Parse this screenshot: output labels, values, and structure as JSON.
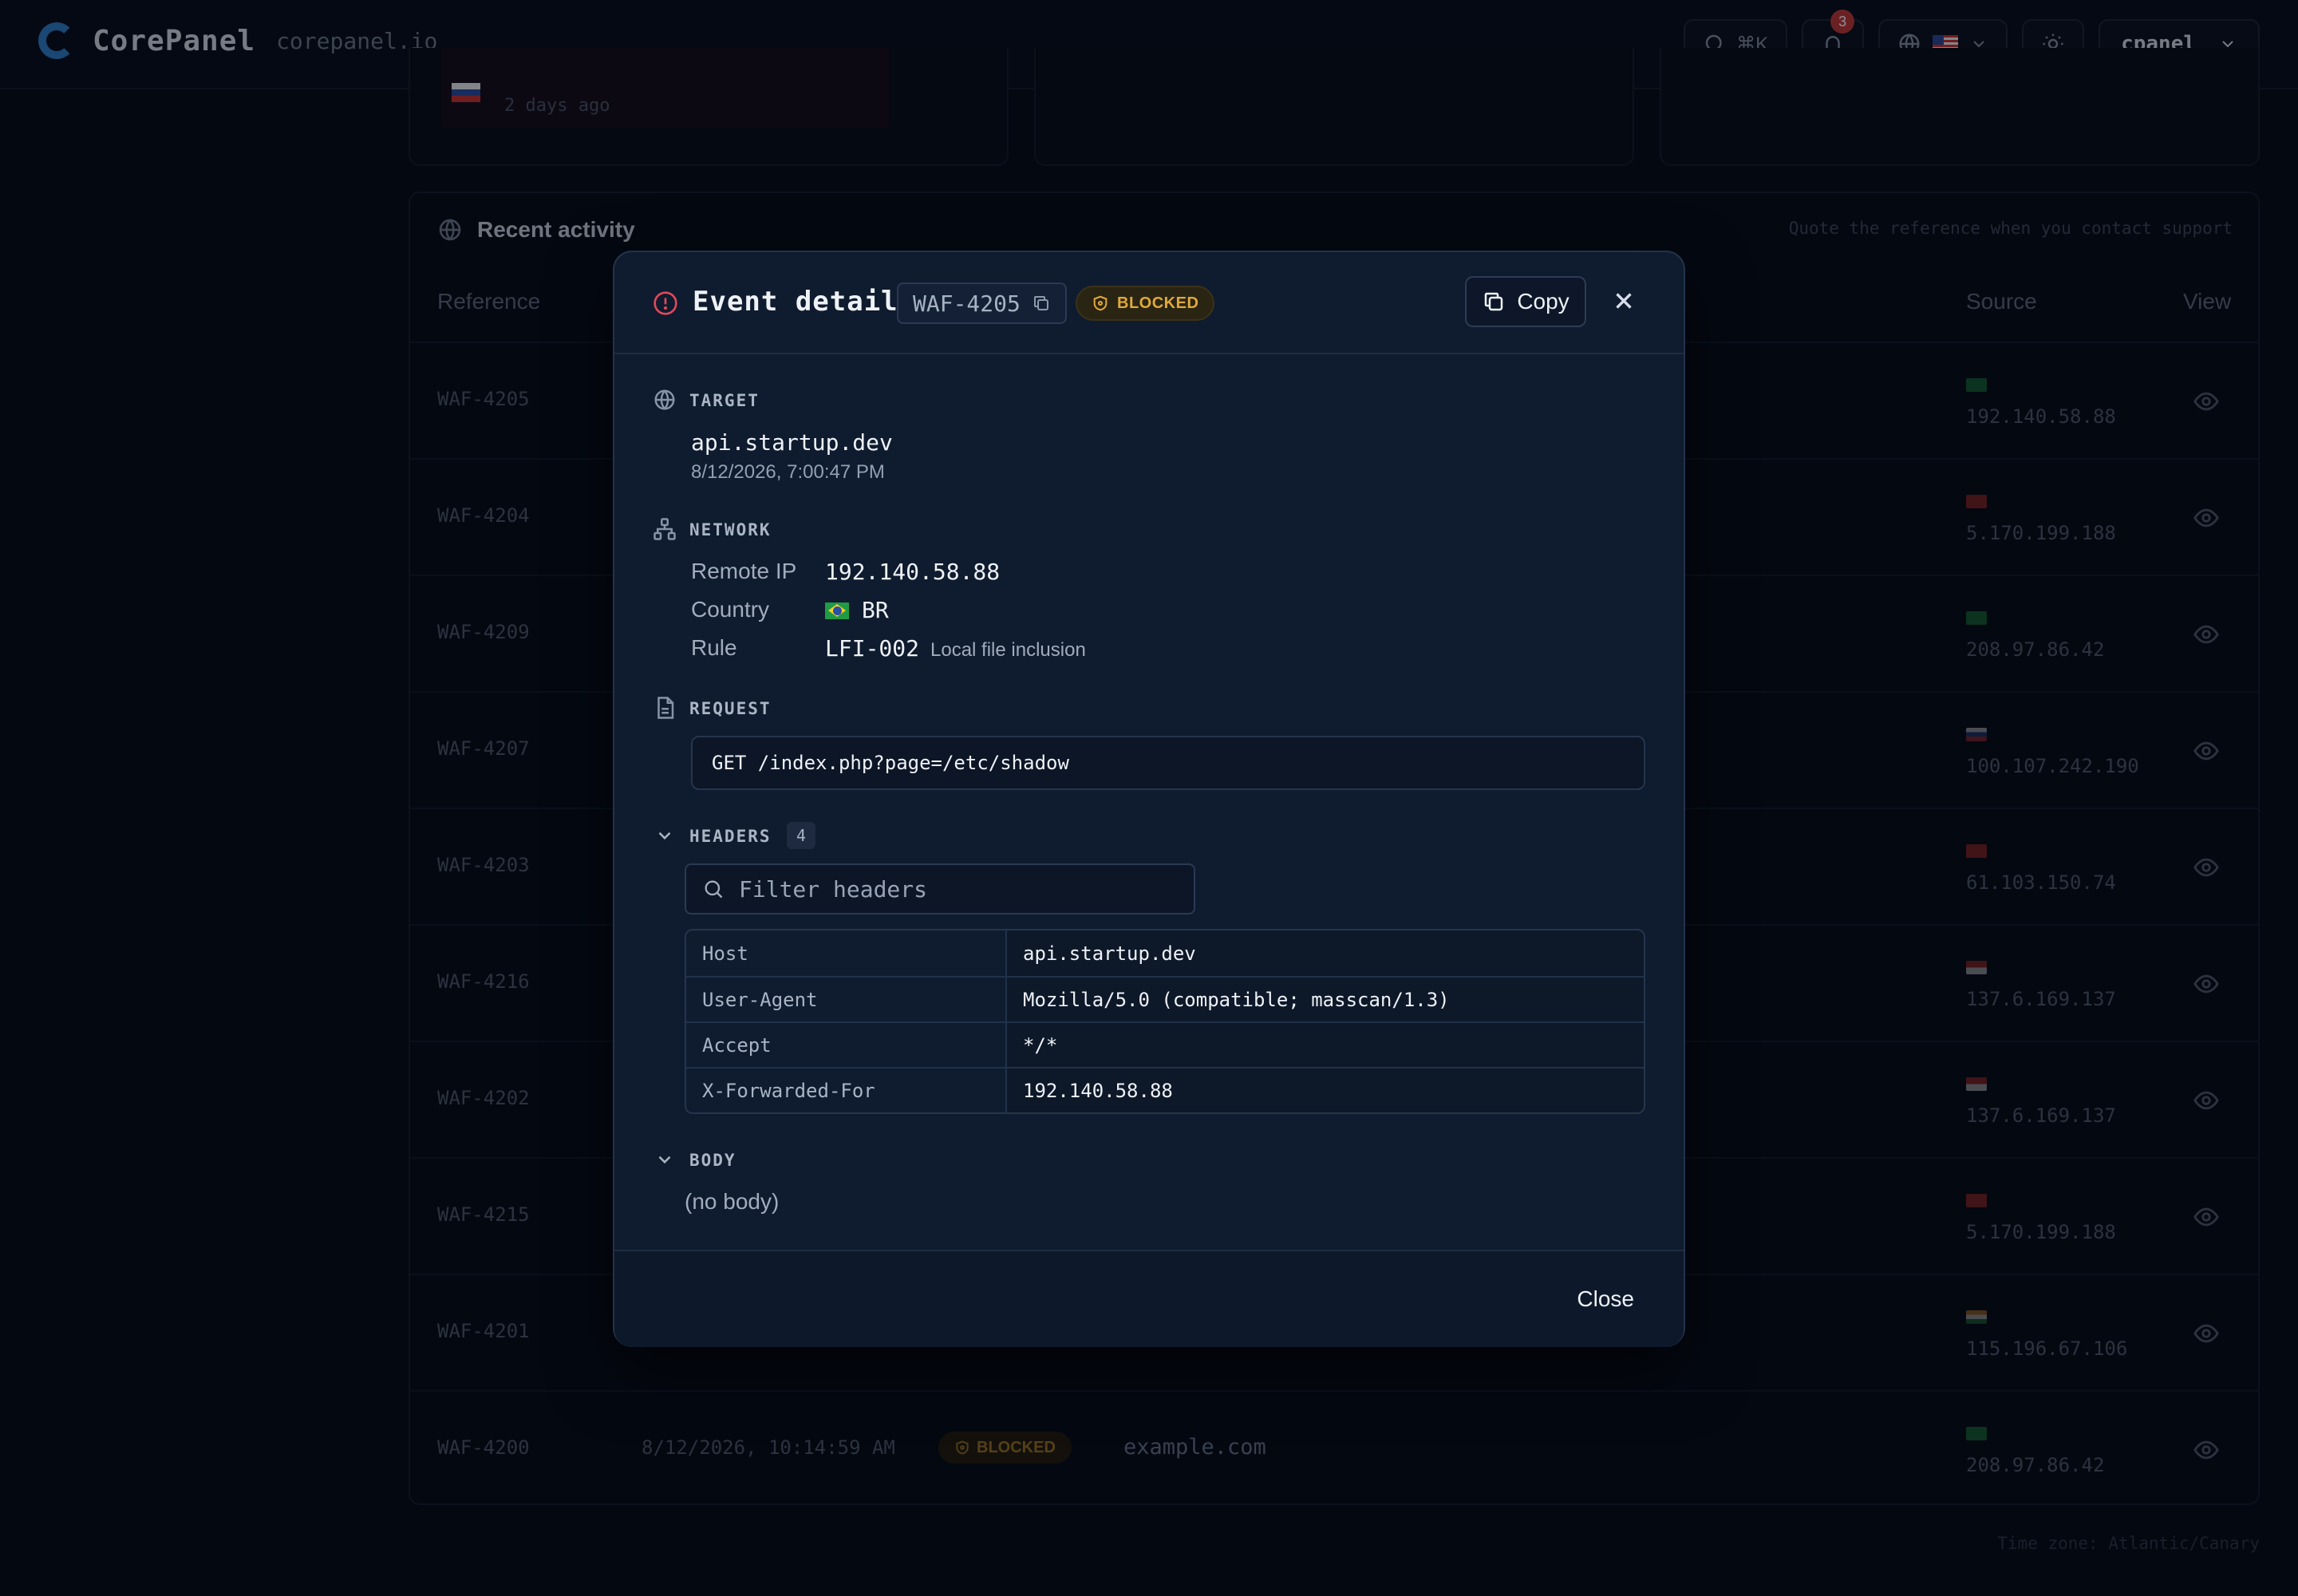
{
  "app": {
    "name": "CorePanel",
    "domain": "corepanel.io",
    "search_shortcut": "⌘K",
    "notification_count": "3",
    "user": "cpanel"
  },
  "stat_card": {
    "ago": "2 days ago"
  },
  "activity": {
    "title": "Recent activity",
    "hint": "Quote the reference when you contact support",
    "columns": {
      "reference": "Reference",
      "source": "Source",
      "view": "View"
    },
    "rows": [
      {
        "ref": "WAF-4205",
        "ip": "192.140.58.88",
        "flag": "BR"
      },
      {
        "ref": "WAF-4204",
        "ip": "5.170.199.188",
        "flag": "CN"
      },
      {
        "ref": "WAF-4209",
        "ip": "208.97.86.42",
        "flag": "BR"
      },
      {
        "ref": "WAF-4207",
        "ip": "100.107.242.190",
        "flag": "RU"
      },
      {
        "ref": "WAF-4203",
        "ip": "61.103.150.74",
        "flag": "CN"
      },
      {
        "ref": "WAF-4216",
        "ip": "137.6.169.137",
        "flag": "ID"
      },
      {
        "ref": "WAF-4202",
        "ip": "137.6.169.137",
        "flag": "ID"
      },
      {
        "ref": "WAF-4215",
        "ip": "5.170.199.188",
        "flag": "CN"
      },
      {
        "ref": "WAF-4201",
        "ip": "115.196.67.106",
        "flag": "IN"
      },
      {
        "ref": "WAF-4200",
        "ip": "208.97.86.42",
        "flag": "BR",
        "time": "8/12/2026, 10:14:59 AM",
        "status": "BLOCKED",
        "host": "example.com"
      }
    ],
    "timezone": "Time zone: Atlantic/Canary"
  },
  "modal": {
    "title": "Event detail",
    "reference": "WAF-4205",
    "status": "BLOCKED",
    "copy_label": "Copy",
    "target": {
      "label": "TARGET",
      "host": "api.startup.dev",
      "time": "8/12/2026, 7:00:47 PM"
    },
    "network": {
      "label": "NETWORK",
      "remote_ip_label": "Remote IP",
      "remote_ip": "192.140.58.88",
      "country_label": "Country",
      "country": "BR",
      "rule_label": "Rule",
      "rule": "LFI-002",
      "rule_desc": "Local file inclusion"
    },
    "request": {
      "label": "REQUEST",
      "line": "GET /index.php?page=/etc/shadow"
    },
    "headers": {
      "label": "HEADERS",
      "count": "4",
      "filter_placeholder": "Filter headers",
      "rows": [
        {
          "key": "Host",
          "value": "api.startup.dev"
        },
        {
          "key": "User-Agent",
          "value": "Mozilla/5.0 (compatible; masscan/1.3)"
        },
        {
          "key": "Accept",
          "value": "*/*"
        },
        {
          "key": "X-Forwarded-For",
          "value": "192.140.58.88"
        }
      ]
    },
    "body": {
      "label": "BODY",
      "content": "(no body)"
    },
    "close_label": "Close"
  },
  "colors": {
    "accent_blue": "#2f7ec9",
    "blocked_amber": "#e0a93a",
    "danger_red": "#e0485b"
  }
}
